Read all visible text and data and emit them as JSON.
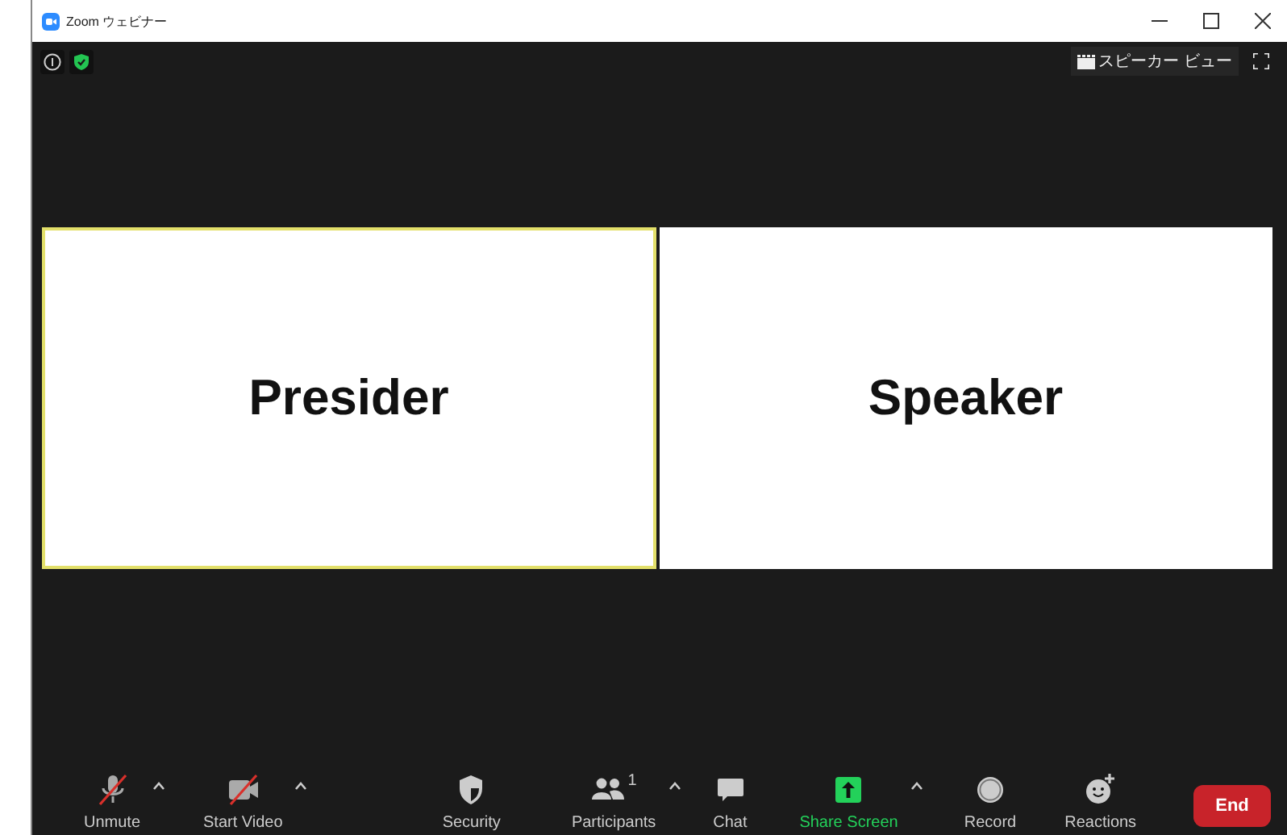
{
  "window": {
    "title": "Zoom ウェビナー"
  },
  "top_bar": {
    "view_button": "スピーカー ビュー"
  },
  "tiles": [
    {
      "label": "Presider",
      "active": true
    },
    {
      "label": "Speaker",
      "active": false
    }
  ],
  "toolbar": {
    "items": [
      {
        "kind": "mic",
        "label": "Unmute",
        "off": true,
        "caret": true
      },
      {
        "kind": "video",
        "label": "Start Video",
        "off": true,
        "caret": true
      },
      {
        "kind": "security",
        "label": "Security",
        "caret": false
      },
      {
        "kind": "participants",
        "label": "Participants",
        "count": "1",
        "caret": true
      },
      {
        "kind": "chat",
        "label": "Chat",
        "caret": false
      },
      {
        "kind": "share",
        "label": "Share Screen",
        "highlighted": true,
        "caret": true
      },
      {
        "kind": "record",
        "label": "Record",
        "caret": false
      },
      {
        "kind": "reactions",
        "label": "Reactions",
        "caret": false
      }
    ],
    "end_button": "End"
  }
}
